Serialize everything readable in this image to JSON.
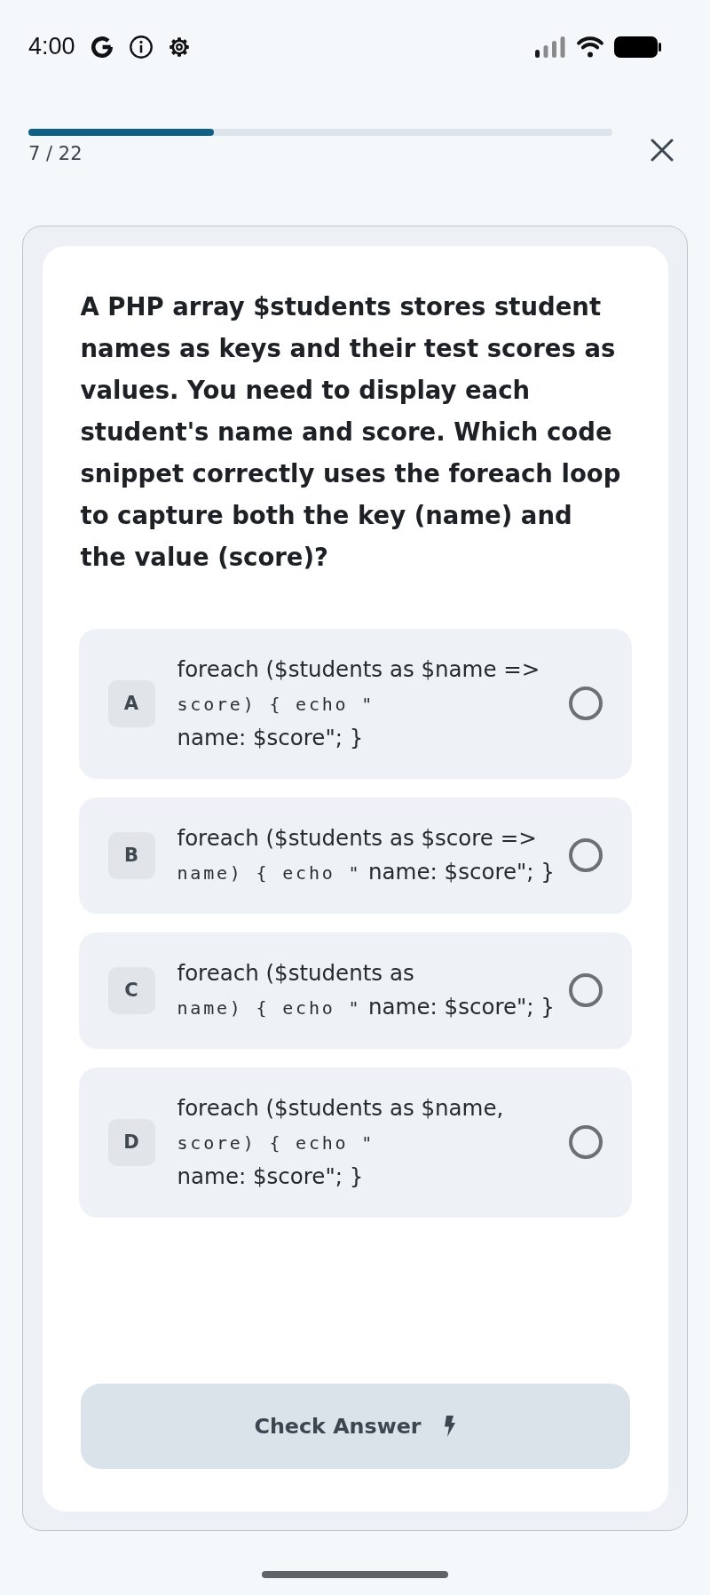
{
  "status_bar": {
    "time": "4:00"
  },
  "progress": {
    "level": 0.318,
    "label": "7 / 22"
  },
  "question": "A PHP array $students stores student names as keys and their test scores as values. You need to display each student's name and score. Which code snippet correctly uses the foreach loop to capture both the key (name) and the value (score)?",
  "options": [
    {
      "letter": "A",
      "selected": false,
      "segments": [
        {
          "kind": "text",
          "text": "foreach ($students as $name =>"
        },
        {
          "kind": "code",
          "text": "score) { echo \""
        },
        {
          "kind": "text",
          "text": "name: $score\"; }"
        }
      ]
    },
    {
      "letter": "B",
      "selected": false,
      "segments": [
        {
          "kind": "text",
          "text": "foreach ($students as $score =>"
        },
        {
          "kind": "code",
          "text": "name) { echo \""
        },
        {
          "kind": "text",
          "text": "name: $score\"; }"
        }
      ]
    },
    {
      "letter": "C",
      "selected": false,
      "segments": [
        {
          "kind": "text",
          "text": "foreach ($students as"
        },
        {
          "kind": "code",
          "text": "name) { echo \""
        },
        {
          "kind": "text",
          "text": "name: $score\"; }"
        }
      ]
    },
    {
      "letter": "D",
      "selected": false,
      "segments": [
        {
          "kind": "text",
          "text": "foreach ($students as $name,"
        },
        {
          "kind": "code",
          "text": "score) { echo \""
        },
        {
          "kind": "text",
          "text": "name: $score\"; }"
        }
      ]
    }
  ],
  "check_button": {
    "label": "Check Answer",
    "disabled": true
  }
}
